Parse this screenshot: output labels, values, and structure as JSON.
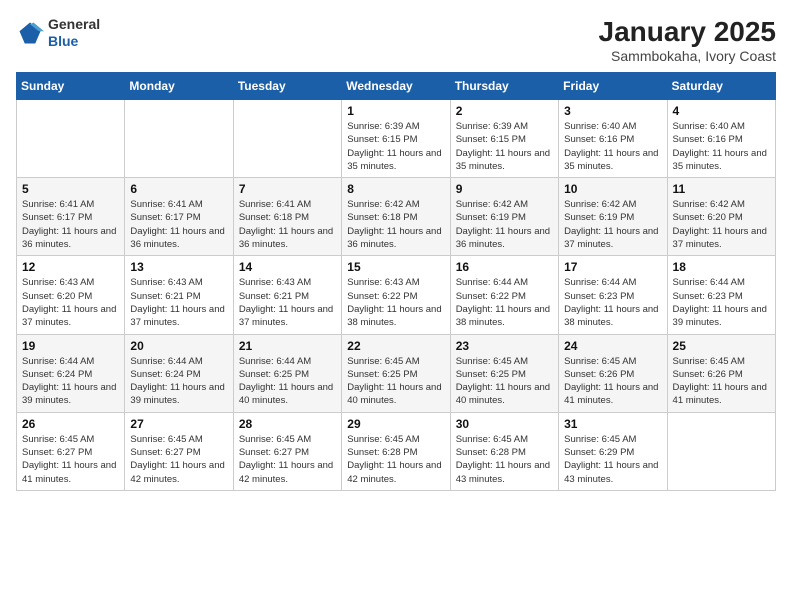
{
  "header": {
    "logo": {
      "general": "General",
      "blue": "Blue"
    },
    "title": "January 2025",
    "subtitle": "Sammbokaha, Ivory Coast"
  },
  "calendar": {
    "days_of_week": [
      "Sunday",
      "Monday",
      "Tuesday",
      "Wednesday",
      "Thursday",
      "Friday",
      "Saturday"
    ],
    "weeks": [
      [
        {
          "day": "",
          "info": ""
        },
        {
          "day": "",
          "info": ""
        },
        {
          "day": "",
          "info": ""
        },
        {
          "day": "1",
          "info": "Sunrise: 6:39 AM\nSunset: 6:15 PM\nDaylight: 11 hours\nand 35 minutes."
        },
        {
          "day": "2",
          "info": "Sunrise: 6:39 AM\nSunset: 6:15 PM\nDaylight: 11 hours\nand 35 minutes."
        },
        {
          "day": "3",
          "info": "Sunrise: 6:40 AM\nSunset: 6:16 PM\nDaylight: 11 hours\nand 35 minutes."
        },
        {
          "day": "4",
          "info": "Sunrise: 6:40 AM\nSunset: 6:16 PM\nDaylight: 11 hours\nand 35 minutes."
        }
      ],
      [
        {
          "day": "5",
          "info": "Sunrise: 6:41 AM\nSunset: 6:17 PM\nDaylight: 11 hours\nand 36 minutes."
        },
        {
          "day": "6",
          "info": "Sunrise: 6:41 AM\nSunset: 6:17 PM\nDaylight: 11 hours\nand 36 minutes."
        },
        {
          "day": "7",
          "info": "Sunrise: 6:41 AM\nSunset: 6:18 PM\nDaylight: 11 hours\nand 36 minutes."
        },
        {
          "day": "8",
          "info": "Sunrise: 6:42 AM\nSunset: 6:18 PM\nDaylight: 11 hours\nand 36 minutes."
        },
        {
          "day": "9",
          "info": "Sunrise: 6:42 AM\nSunset: 6:19 PM\nDaylight: 11 hours\nand 36 minutes."
        },
        {
          "day": "10",
          "info": "Sunrise: 6:42 AM\nSunset: 6:19 PM\nDaylight: 11 hours\nand 37 minutes."
        },
        {
          "day": "11",
          "info": "Sunrise: 6:42 AM\nSunset: 6:20 PM\nDaylight: 11 hours\nand 37 minutes."
        }
      ],
      [
        {
          "day": "12",
          "info": "Sunrise: 6:43 AM\nSunset: 6:20 PM\nDaylight: 11 hours\nand 37 minutes."
        },
        {
          "day": "13",
          "info": "Sunrise: 6:43 AM\nSunset: 6:21 PM\nDaylight: 11 hours\nand 37 minutes."
        },
        {
          "day": "14",
          "info": "Sunrise: 6:43 AM\nSunset: 6:21 PM\nDaylight: 11 hours\nand 37 minutes."
        },
        {
          "day": "15",
          "info": "Sunrise: 6:43 AM\nSunset: 6:22 PM\nDaylight: 11 hours\nand 38 minutes."
        },
        {
          "day": "16",
          "info": "Sunrise: 6:44 AM\nSunset: 6:22 PM\nDaylight: 11 hours\nand 38 minutes."
        },
        {
          "day": "17",
          "info": "Sunrise: 6:44 AM\nSunset: 6:23 PM\nDaylight: 11 hours\nand 38 minutes."
        },
        {
          "day": "18",
          "info": "Sunrise: 6:44 AM\nSunset: 6:23 PM\nDaylight: 11 hours\nand 39 minutes."
        }
      ],
      [
        {
          "day": "19",
          "info": "Sunrise: 6:44 AM\nSunset: 6:24 PM\nDaylight: 11 hours\nand 39 minutes."
        },
        {
          "day": "20",
          "info": "Sunrise: 6:44 AM\nSunset: 6:24 PM\nDaylight: 11 hours\nand 39 minutes."
        },
        {
          "day": "21",
          "info": "Sunrise: 6:44 AM\nSunset: 6:25 PM\nDaylight: 11 hours\nand 40 minutes."
        },
        {
          "day": "22",
          "info": "Sunrise: 6:45 AM\nSunset: 6:25 PM\nDaylight: 11 hours\nand 40 minutes."
        },
        {
          "day": "23",
          "info": "Sunrise: 6:45 AM\nSunset: 6:25 PM\nDaylight: 11 hours\nand 40 minutes."
        },
        {
          "day": "24",
          "info": "Sunrise: 6:45 AM\nSunset: 6:26 PM\nDaylight: 11 hours\nand 41 minutes."
        },
        {
          "day": "25",
          "info": "Sunrise: 6:45 AM\nSunset: 6:26 PM\nDaylight: 11 hours\nand 41 minutes."
        }
      ],
      [
        {
          "day": "26",
          "info": "Sunrise: 6:45 AM\nSunset: 6:27 PM\nDaylight: 11 hours\nand 41 minutes."
        },
        {
          "day": "27",
          "info": "Sunrise: 6:45 AM\nSunset: 6:27 PM\nDaylight: 11 hours\nand 42 minutes."
        },
        {
          "day": "28",
          "info": "Sunrise: 6:45 AM\nSunset: 6:27 PM\nDaylight: 11 hours\nand 42 minutes."
        },
        {
          "day": "29",
          "info": "Sunrise: 6:45 AM\nSunset: 6:28 PM\nDaylight: 11 hours\nand 42 minutes."
        },
        {
          "day": "30",
          "info": "Sunrise: 6:45 AM\nSunset: 6:28 PM\nDaylight: 11 hours\nand 43 minutes."
        },
        {
          "day": "31",
          "info": "Sunrise: 6:45 AM\nSunset: 6:29 PM\nDaylight: 11 hours\nand 43 minutes."
        },
        {
          "day": "",
          "info": ""
        }
      ]
    ]
  }
}
